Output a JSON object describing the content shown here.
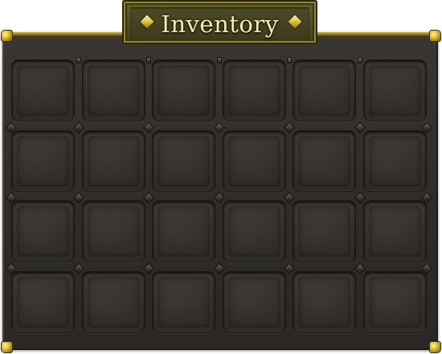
{
  "window": {
    "title": "Inventory"
  },
  "inventory": {
    "rows": 4,
    "columns": 6,
    "slots": [
      {
        "row": 1,
        "col": 1,
        "item": null
      },
      {
        "row": 1,
        "col": 2,
        "item": null
      },
      {
        "row": 1,
        "col": 3,
        "item": null
      },
      {
        "row": 1,
        "col": 4,
        "item": null
      },
      {
        "row": 1,
        "col": 5,
        "item": null
      },
      {
        "row": 1,
        "col": 6,
        "item": null
      },
      {
        "row": 2,
        "col": 1,
        "item": null
      },
      {
        "row": 2,
        "col": 2,
        "item": null
      },
      {
        "row": 2,
        "col": 3,
        "item": null
      },
      {
        "row": 2,
        "col": 4,
        "item": null
      },
      {
        "row": 2,
        "col": 5,
        "item": null
      },
      {
        "row": 2,
        "col": 6,
        "item": null
      },
      {
        "row": 3,
        "col": 1,
        "item": null
      },
      {
        "row": 3,
        "col": 2,
        "item": null
      },
      {
        "row": 3,
        "col": 3,
        "item": null
      },
      {
        "row": 3,
        "col": 4,
        "item": null
      },
      {
        "row": 3,
        "col": 5,
        "item": null
      },
      {
        "row": 3,
        "col": 6,
        "item": null
      },
      {
        "row": 4,
        "col": 1,
        "item": null
      },
      {
        "row": 4,
        "col": 2,
        "item": null
      },
      {
        "row": 4,
        "col": 3,
        "item": null
      },
      {
        "row": 4,
        "col": 4,
        "item": null
      },
      {
        "row": 4,
        "col": 5,
        "item": null
      },
      {
        "row": 4,
        "col": 6,
        "item": null
      }
    ]
  },
  "theme": {
    "panel_color": "#34312d",
    "trim_gold": "#c9b24a",
    "title_text_color": "#f6ecb0",
    "title_plate_color": "#57511f"
  },
  "icons": {
    "title_left": "diamond-gem-icon",
    "title_right": "diamond-gem-icon",
    "corners": "gold-corner-stud-icon"
  }
}
